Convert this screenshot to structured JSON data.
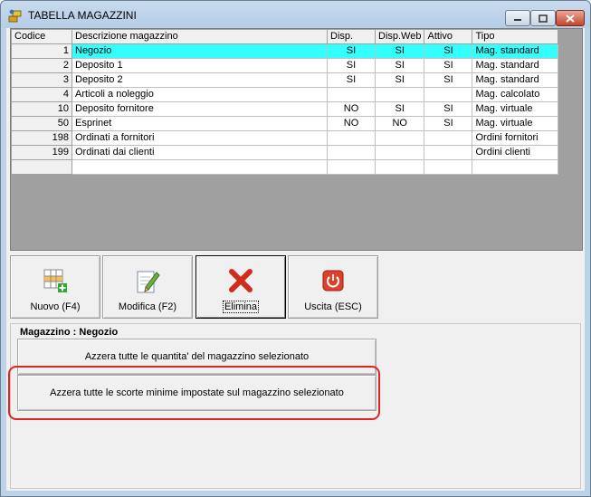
{
  "window": {
    "title": "TABELLA MAGAZZINI"
  },
  "grid": {
    "columns": [
      "Codice",
      "Descrizione magazzino",
      "Disp.",
      "Disp.Web",
      "Attivo",
      "Tipo"
    ],
    "rows": [
      {
        "codice": "1",
        "descrizione": "Negozio",
        "disp": "SI",
        "disp_web": "SI",
        "attivo": "SI",
        "tipo": "Mag. standard"
      },
      {
        "codice": "2",
        "descrizione": "Deposito 1",
        "disp": "SI",
        "disp_web": "SI",
        "attivo": "SI",
        "tipo": "Mag. standard"
      },
      {
        "codice": "3",
        "descrizione": "Deposito 2",
        "disp": "SI",
        "disp_web": "SI",
        "attivo": "SI",
        "tipo": "Mag. standard"
      },
      {
        "codice": "4",
        "descrizione": "Articoli a noleggio",
        "disp": "",
        "disp_web": "",
        "attivo": "",
        "tipo": "Mag. calcolato"
      },
      {
        "codice": "10",
        "descrizione": "Deposito fornitore",
        "disp": "NO",
        "disp_web": "SI",
        "attivo": "SI",
        "tipo": "Mag. virtuale"
      },
      {
        "codice": "50",
        "descrizione": "Esprinet",
        "disp": "NO",
        "disp_web": "NO",
        "attivo": "SI",
        "tipo": "Mag. virtuale"
      },
      {
        "codice": "198",
        "descrizione": "Ordinati a fornitori",
        "disp": "",
        "disp_web": "",
        "attivo": "",
        "tipo": "Ordini fornitori"
      },
      {
        "codice": "199",
        "descrizione": "Ordinati dai clienti",
        "disp": "",
        "disp_web": "",
        "attivo": "",
        "tipo": "Ordini clienti"
      },
      {
        "codice": "",
        "descrizione": "",
        "disp": "",
        "disp_web": "",
        "attivo": "",
        "tipo": ""
      }
    ],
    "selected_index": 0,
    "selected_color": "#33ffff"
  },
  "toolbar": {
    "buttons": [
      {
        "label": "Nuovo (F4)",
        "icon": "new-grid-icon"
      },
      {
        "label": "Modifica (F2)",
        "icon": "edit-pencil-icon"
      },
      {
        "label": "Elimina",
        "icon": "red-x-icon"
      },
      {
        "label": "Uscita (ESC)",
        "icon": "power-exit-icon"
      }
    ]
  },
  "section": {
    "title": "Magazzino : Negozio",
    "reset_quantities_label": "Azzera tutte le quantita' del magazzino selezionato",
    "reset_min_stock_label": "Azzera tutte le scorte minime impostate sul magazzino selezionato"
  }
}
